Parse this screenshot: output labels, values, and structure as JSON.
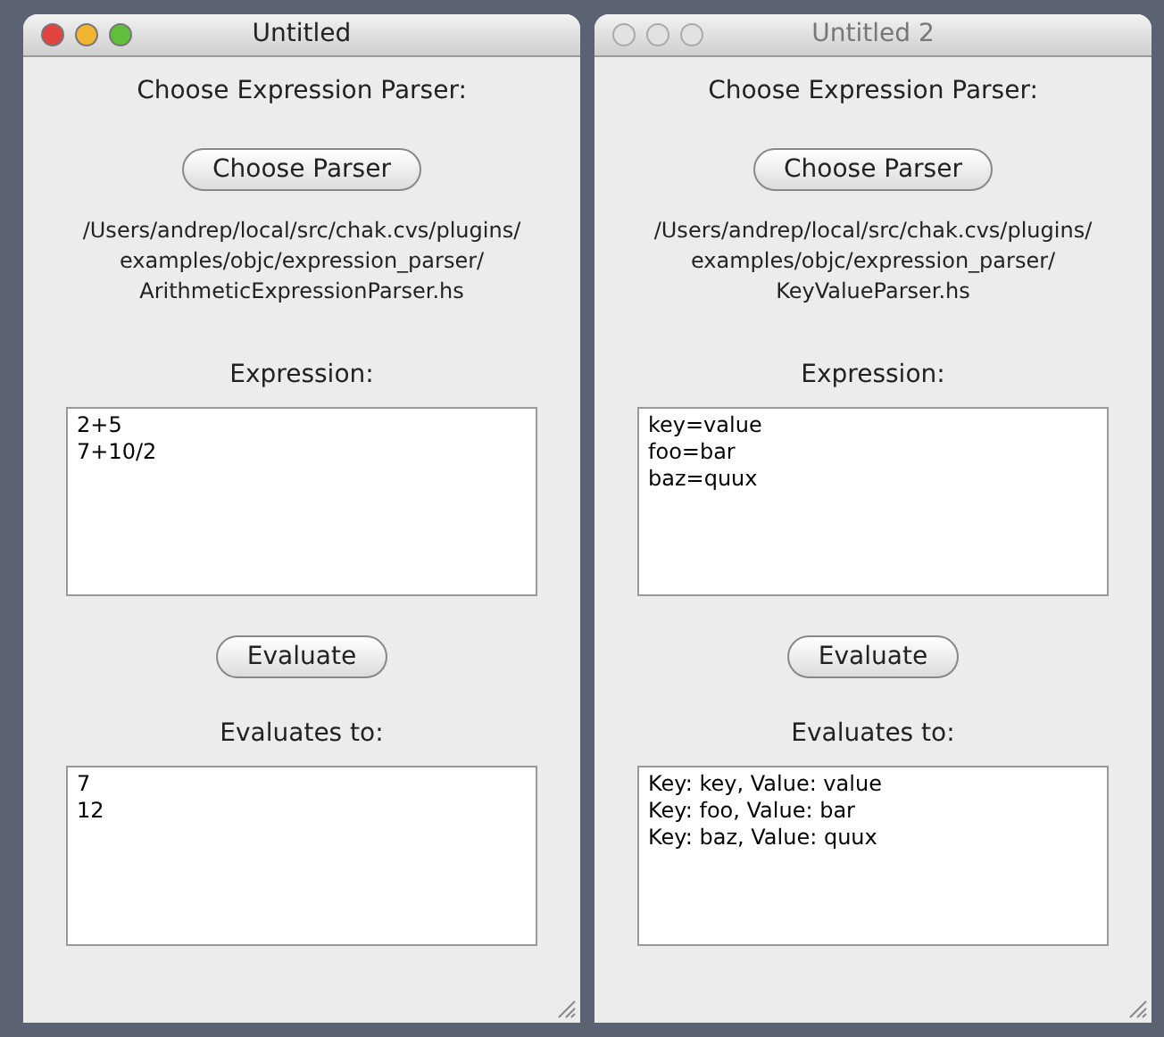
{
  "windows": [
    {
      "title": "Untitled",
      "active": true,
      "prompt": "Choose Expression Parser:",
      "choose_button": "Choose Parser",
      "path_lines": [
        "/Users/andrep/local/src/chak.cvs/plugins/",
        "examples/objc/expression_parser/",
        "ArithmeticExpressionParser.hs"
      ],
      "expression_label": "Expression:",
      "expression_lines": [
        "2+5",
        "7+10/2"
      ],
      "evaluate_button": "Evaluate",
      "result_label": "Evaluates to:",
      "result_lines": [
        "7",
        "12"
      ]
    },
    {
      "title": "Untitled 2",
      "active": false,
      "prompt": "Choose Expression Parser:",
      "choose_button": "Choose Parser",
      "path_lines": [
        "/Users/andrep/local/src/chak.cvs/plugins/",
        "examples/objc/expression_parser/",
        "KeyValueParser.hs"
      ],
      "expression_label": "Expression:",
      "expression_lines": [
        "key=value",
        "foo=bar",
        "baz=quux"
      ],
      "evaluate_button": "Evaluate",
      "result_label": "Evaluates to:",
      "result_lines": [
        "Key: key, Value: value",
        "Key: foo, Value: bar",
        "Key: baz, Value: quux"
      ]
    }
  ]
}
